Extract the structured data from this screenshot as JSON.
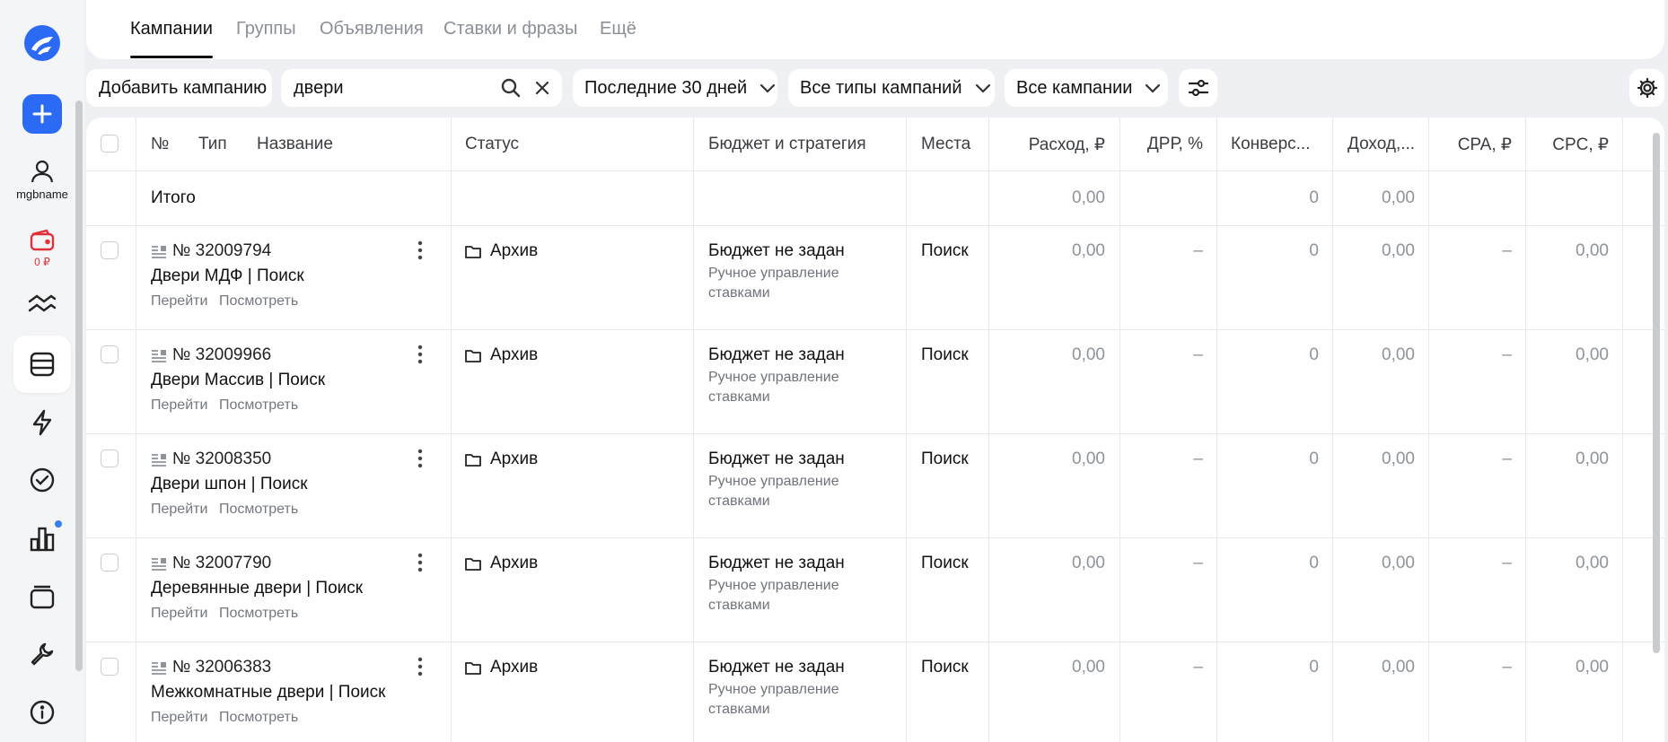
{
  "sidebar": {
    "user_label": "mgbname",
    "wallet_amount": "0 ₽",
    "accent_color": "#2b6af5",
    "items": [
      {
        "icon": "logo-icon"
      },
      {
        "icon": "plus-icon"
      },
      {
        "icon": "user-icon"
      },
      {
        "icon": "wallet-icon"
      },
      {
        "icon": "waves-icon"
      },
      {
        "icon": "campaigns-icon"
      },
      {
        "icon": "lightning-icon"
      },
      {
        "icon": "check-circle-icon"
      },
      {
        "icon": "stats-icon"
      },
      {
        "icon": "stack-icon"
      },
      {
        "icon": "wrench-icon"
      },
      {
        "icon": "info-icon"
      }
    ]
  },
  "tabs": [
    "Кампании",
    "Группы",
    "Объявления",
    "Ставки и фразы",
    "Ещё"
  ],
  "toolbar": {
    "add_campaign": "Добавить кампанию",
    "search_value": "двери",
    "period": "Последние 30 дней",
    "types": "Все типы кампаний",
    "campaigns": "Все кампании"
  },
  "table": {
    "headers": {
      "num": "№",
      "type": "Тип",
      "name": "Название",
      "status": "Статус",
      "budget": "Бюджет и стратегия",
      "places": "Места",
      "expense": "Расход, ₽",
      "drr": "ДРР, %",
      "conversions": "Конверс...",
      "income": "Доход,...",
      "cpa": "CPA, ₽",
      "cpc": "CPC, ₽"
    },
    "total": {
      "label": "Итого",
      "expense": "0,00",
      "conversions": "0",
      "income": "0,00"
    },
    "link_go": "Перейти",
    "link_view": "Посмотреть",
    "rows": [
      {
        "id": "№ 32009794",
        "name": "Двери МДФ | Поиск",
        "status": "Архив",
        "budget": "Бюджет не задан",
        "strategy": "Ручное управление ставками",
        "places": "Поиск",
        "expense": "0,00",
        "drr": "–",
        "conversions": "0",
        "income": "0,00",
        "cpa": "–",
        "cpc": "0,00"
      },
      {
        "id": "№ 32009966",
        "name": "Двери Массив | Поиск",
        "status": "Архив",
        "budget": "Бюджет не задан",
        "strategy": "Ручное управление ставками",
        "places": "Поиск",
        "expense": "0,00",
        "drr": "–",
        "conversions": "0",
        "income": "0,00",
        "cpa": "–",
        "cpc": "0,00"
      },
      {
        "id": "№ 32008350",
        "name": "Двери шпон | Поиск",
        "status": "Архив",
        "budget": "Бюджет не задан",
        "strategy": "Ручное управление ставками",
        "places": "Поиск",
        "expense": "0,00",
        "drr": "–",
        "conversions": "0",
        "income": "0,00",
        "cpa": "–",
        "cpc": "0,00"
      },
      {
        "id": "№ 32007790",
        "name": "Деревянные двери | Поиск",
        "status": "Архив",
        "budget": "Бюджет не задан",
        "strategy": "Ручное управление ставками",
        "places": "Поиск",
        "expense": "0,00",
        "drr": "–",
        "conversions": "0",
        "income": "0,00",
        "cpa": "–",
        "cpc": "0,00"
      },
      {
        "id": "№ 32006383",
        "name": "Межкомнатные двери | Поиск",
        "status": "Архив",
        "budget": "Бюджет не задан",
        "strategy": "Ручное управление ставками",
        "places": "Поиск",
        "expense": "0,00",
        "drr": "–",
        "conversions": "0",
        "income": "0,00",
        "cpa": "–",
        "cpc": "0,00"
      }
    ]
  }
}
